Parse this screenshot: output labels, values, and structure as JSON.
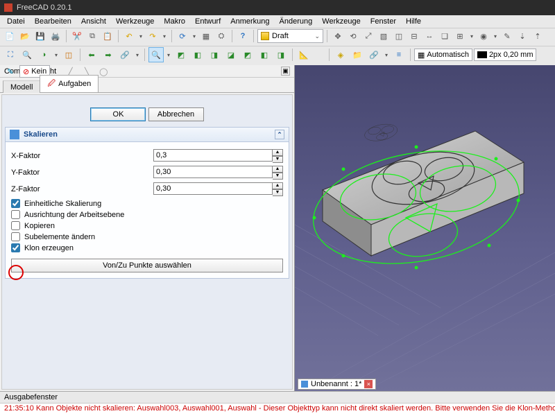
{
  "app": {
    "title": "FreeCAD 0.20.1"
  },
  "menu": [
    "Datei",
    "Bearbeiten",
    "Ansicht",
    "Werkzeuge",
    "Makro",
    "Entwurf",
    "Anmerkung",
    "Änderung",
    "Werkzeuge",
    "Fenster",
    "Hilfe"
  ],
  "workbench": {
    "selected": "Draft"
  },
  "snap": {
    "auto_label": "Automatisch",
    "px_label": "2px",
    "mm_label": "0,20 mm",
    "none_label": "Kein"
  },
  "combo": {
    "title": "Combo-Ansicht",
    "tab_model": "Modell",
    "tab_tasks": "Aufgaben",
    "ok": "OK",
    "cancel": "Abbrechen"
  },
  "task": {
    "title": "Skalieren",
    "x_label": "X-Faktor",
    "y_label": "Y-Faktor",
    "z_label": "Z-Faktor",
    "x_val": "0,3",
    "y_val": "0,30",
    "z_val": "0,30",
    "uniform": {
      "label": "Einheitliche Skalierung",
      "checked": true
    },
    "wp": {
      "label": "Ausrichtung der Arbeitsebene",
      "checked": false
    },
    "copy": {
      "label": "Kopieren",
      "checked": false
    },
    "subel": {
      "label": "Subelemente ändern",
      "checked": false
    },
    "clone": {
      "label": "Klon erzeugen",
      "checked": true
    },
    "pick_btn": "Von/Zu Punkte auswählen"
  },
  "doc": {
    "tab_label": "Unbenannt : 1*"
  },
  "output": {
    "title": "Ausgabefenster",
    "line": "21:35:10  Kann Objekte nicht skalieren: Auswahl003, Auswahl001, Auswahl - Dieser Objekttyp kann nicht direkt skaliert werden. Bitte verwenden Sie die Klon-Methode."
  }
}
